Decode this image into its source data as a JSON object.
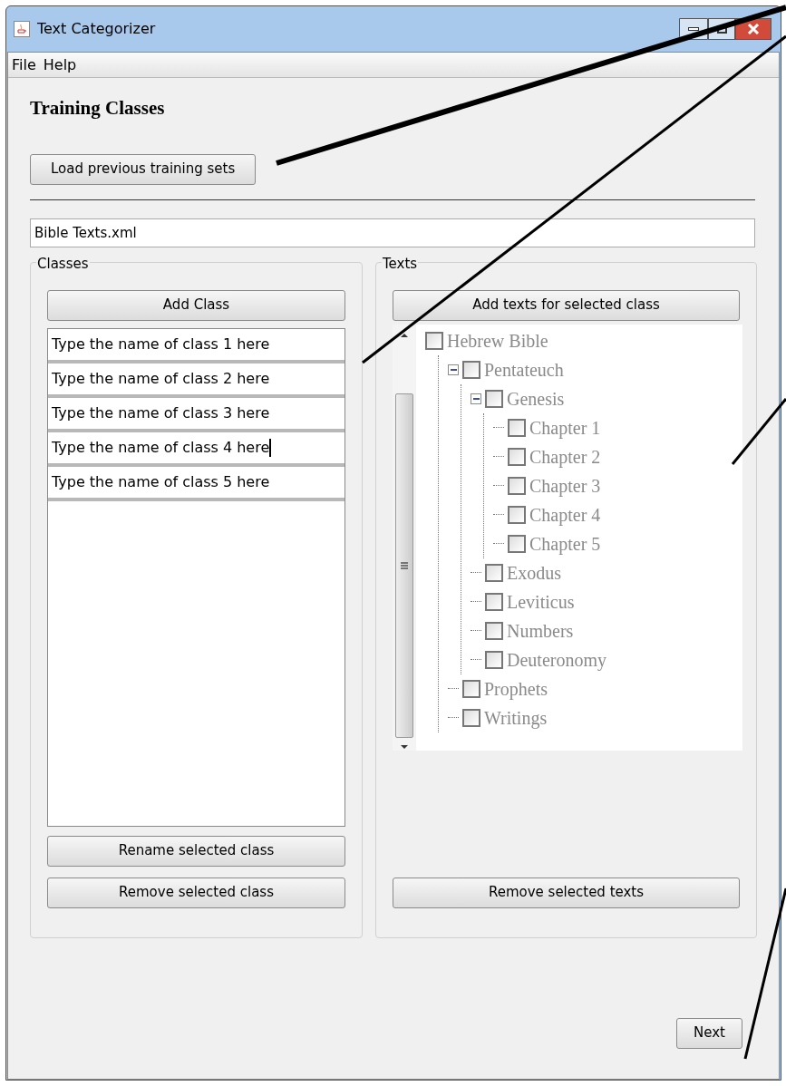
{
  "window": {
    "title": "Text Categorizer"
  },
  "menu": [
    "File",
    "Help"
  ],
  "heading": "Training Classes",
  "load_button": "Load previous training sets",
  "file_field": {
    "value": "Bible Texts.xml"
  },
  "classes_panel": {
    "title": "Classes",
    "add_button": "Add Class",
    "items": [
      {
        "value": "Type the name of class 1 here",
        "focused": false
      },
      {
        "value": "Type the name of class 2 here",
        "focused": false
      },
      {
        "value": "Type the name of class 3 here",
        "focused": false
      },
      {
        "value": "Type the name of class 4 here",
        "focused": true
      },
      {
        "value": "Type the name of class 5 here",
        "focused": false
      }
    ],
    "buttons": [
      "Rename selected class",
      "Remove selected class"
    ]
  },
  "texts_panel": {
    "title": "Texts",
    "add_button": "Add texts for selected class",
    "tree": [
      {
        "label": "Hebrew Bible",
        "checked": false,
        "children": [
          {
            "label": "Pentateuch",
            "checked": false,
            "expanded": true,
            "children": [
              {
                "label": "Genesis",
                "checked": false,
                "expanded": true,
                "children": [
                  {
                    "label": "Chapter 1",
                    "checked": false
                  },
                  {
                    "label": "Chapter 2",
                    "checked": false
                  },
                  {
                    "label": "Chapter 3",
                    "checked": false
                  },
                  {
                    "label": "Chapter 4",
                    "checked": false
                  },
                  {
                    "label": "Chapter 5",
                    "checked": false
                  }
                ]
              },
              {
                "label": "Exodus",
                "checked": false
              },
              {
                "label": "Leviticus",
                "checked": false
              },
              {
                "label": "Numbers",
                "checked": false
              },
              {
                "label": "Deuteronomy",
                "checked": false
              }
            ]
          },
          {
            "label": "Prophets",
            "checked": false
          },
          {
            "label": "Writings",
            "checked": false
          }
        ]
      }
    ],
    "remove_button": "Remove selected texts"
  },
  "next_button": "Next"
}
